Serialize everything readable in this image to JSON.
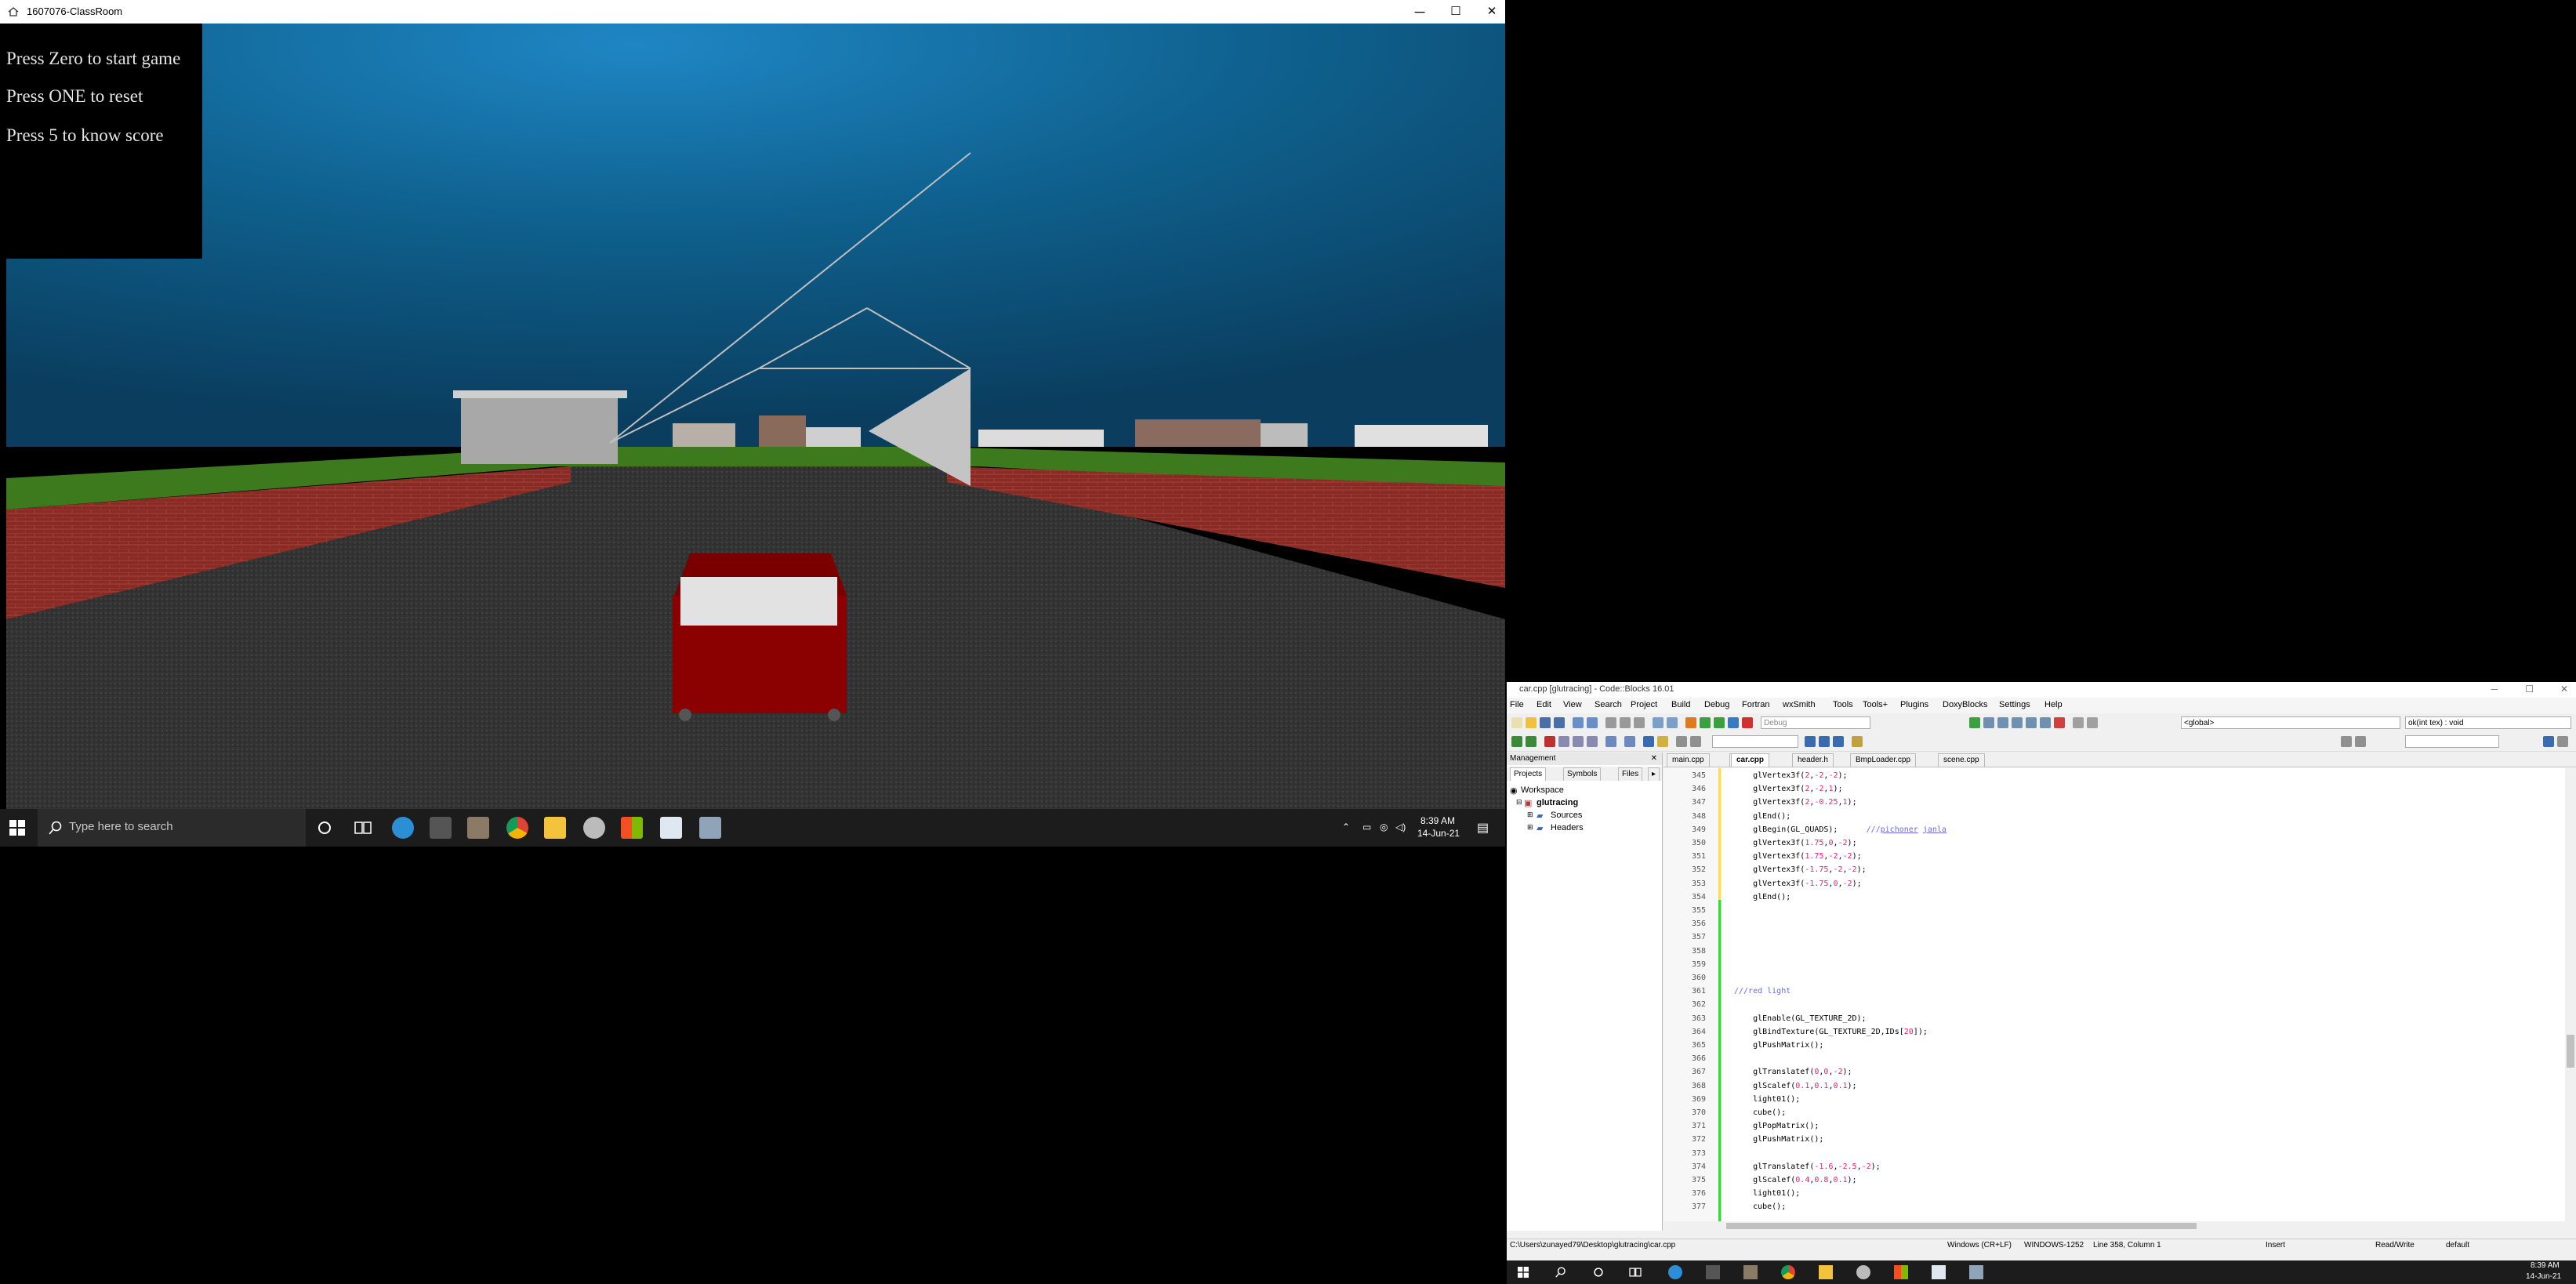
{
  "game_window": {
    "title": "1607076-ClassRoom",
    "info_lines": [
      "Press Zero to start game",
      "Press ONE to reset",
      "Press 5 to know score"
    ],
    "controls": {
      "minimize": "─",
      "maximize": "☐",
      "close": "✕"
    }
  },
  "taskbar_left": {
    "search_placeholder": "Type here to search",
    "time": "8:39 AM",
    "date": "14-Jun-21"
  },
  "ide": {
    "title": "car.cpp [glutracing] - Code::Blocks 16.01",
    "menu": [
      "File",
      "Edit",
      "View",
      "Search",
      "Project",
      "Build",
      "Debug",
      "Fortran",
      "wxSmith",
      "Tools",
      "Tools+",
      "Plugins",
      "DoxyBlocks",
      "Settings",
      "Help"
    ],
    "build_target": "Debug",
    "scope": "<global>",
    "function": "ok(int tex) : void",
    "management": {
      "title": "Management",
      "tabs": [
        "Projects",
        "Symbols",
        "Files"
      ],
      "tree": {
        "workspace": "Workspace",
        "project": "glutracing",
        "folders": [
          "Sources",
          "Headers"
        ]
      }
    },
    "editor_tabs": [
      "main.cpp",
      "car.cpp",
      "header.h",
      "BmpLoader.cpp",
      "scene.cpp"
    ],
    "active_tab": "car.cpp",
    "line_numbers": [
      "345",
      "346",
      "347",
      "348",
      "349",
      "350",
      "351",
      "352",
      "353",
      "354",
      "355",
      "356",
      "357",
      "358",
      "359",
      "360",
      "361",
      "362",
      "363",
      "364",
      "365",
      "366",
      "367",
      "368",
      "369",
      "370",
      "371",
      "372",
      "373",
      "374",
      "375",
      "376",
      "377"
    ],
    "status": {
      "path": "C:\\Users\\zunayed79\\Desktop\\glutracing\\car.cpp",
      "eol": "Windows (CR+LF)",
      "encoding": "WINDOWS-1252",
      "position": "Line 358, Column 1",
      "mode": "Insert",
      "access": "Read/Write",
      "lang": "default"
    }
  },
  "taskbar_right": {
    "time": "8:39 AM",
    "date": "14-Jun-21"
  }
}
